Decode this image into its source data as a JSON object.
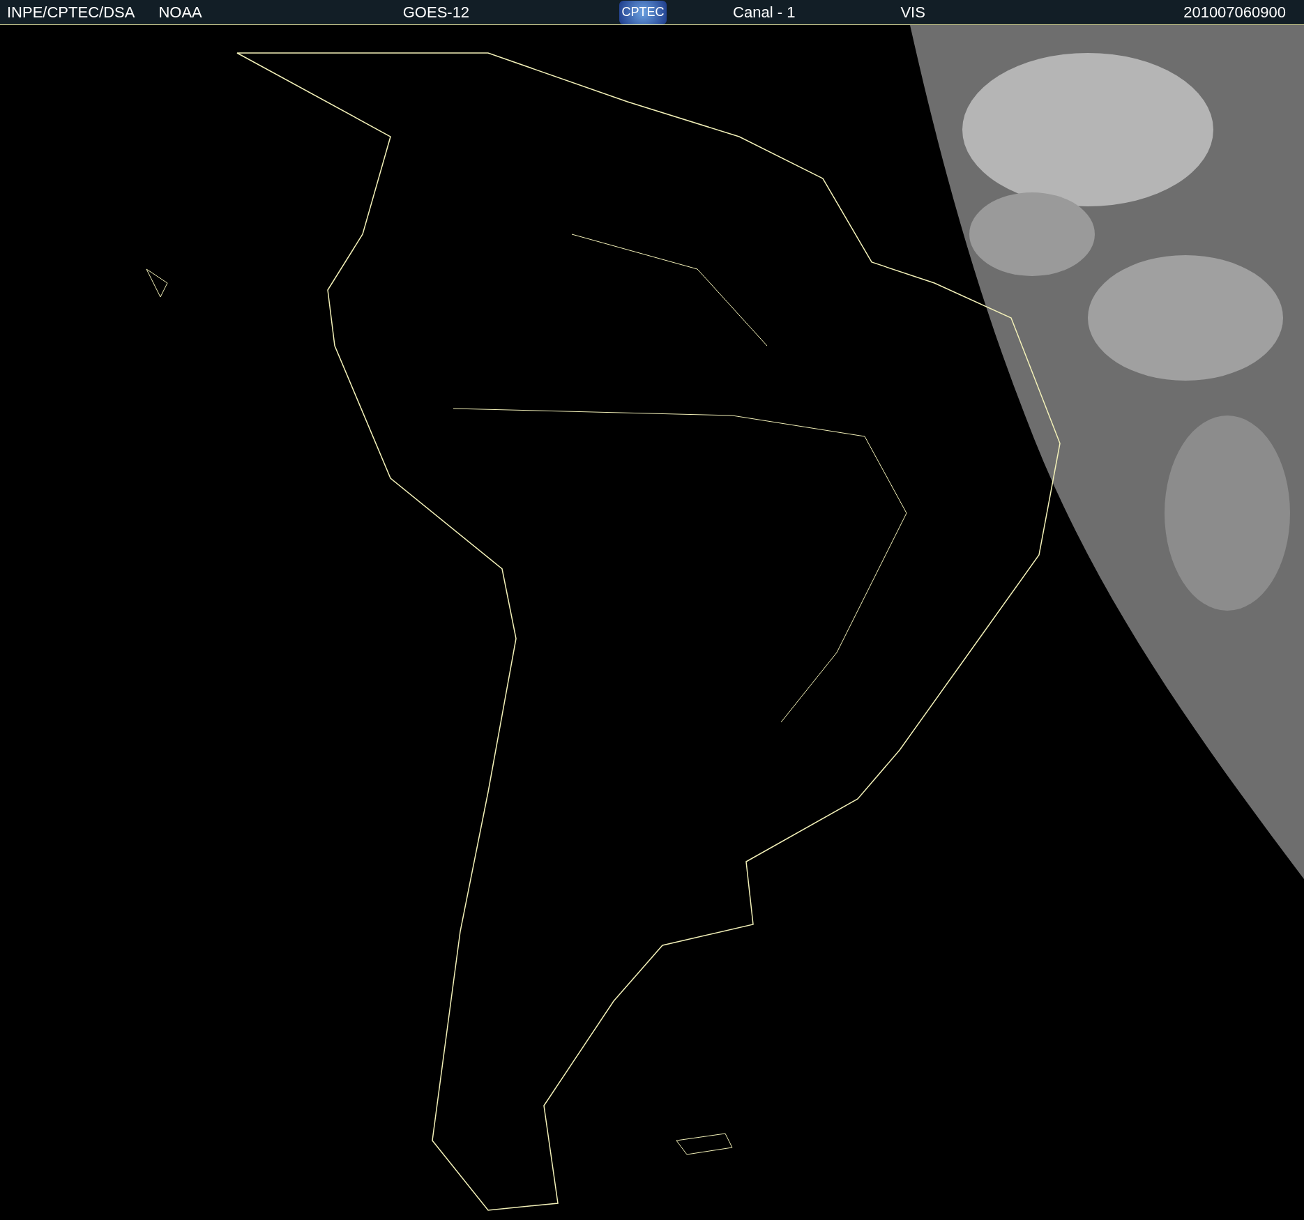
{
  "header": {
    "institution": "INPE/CPTEC/DSA",
    "agency": "NOAA",
    "satellite": "GOES-12",
    "logo": "CPTEC",
    "channel": "Canal - 1",
    "band": "VIS",
    "timestamp": "201007060900"
  }
}
